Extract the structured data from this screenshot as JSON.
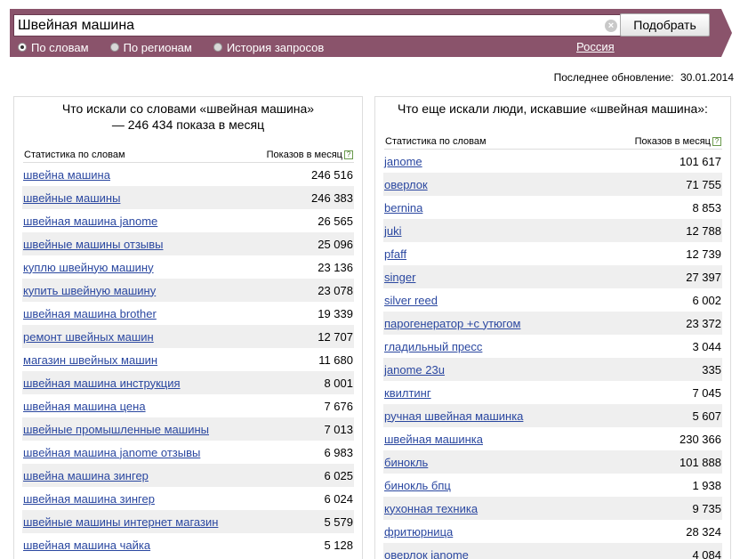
{
  "search": {
    "query": "Швейная машина",
    "clear_symbol": "×",
    "submit_label": "Подобрать",
    "modes": [
      {
        "label": "По словам",
        "checked": true
      },
      {
        "label": "По регионам",
        "checked": false
      },
      {
        "label": "История запросов",
        "checked": false
      }
    ],
    "region": "Россия"
  },
  "colors": {
    "banner": "#8a536b",
    "link": "#2a47a0",
    "row_alt": "#efefef"
  },
  "updated": {
    "label": "Последнее обновление:",
    "date": "30.01.2014"
  },
  "left_panel": {
    "title": "Что искали со словами «швейная машина» — 246 434 показа в месяц",
    "col_words": "Статистика по словам",
    "col_count": "Показов в месяц",
    "help": "?",
    "rows": [
      {
        "phrase": "швейна машина",
        "count": "246 516"
      },
      {
        "phrase": "швейные машины",
        "count": "246 383"
      },
      {
        "phrase": "швейная машина janome",
        "count": "26 565"
      },
      {
        "phrase": "швейные машины отзывы",
        "count": "25 096"
      },
      {
        "phrase": "куплю швейную машину",
        "count": "23 136"
      },
      {
        "phrase": "купить швейную машину",
        "count": "23 078"
      },
      {
        "phrase": "швейная машина brother",
        "count": "19 339"
      },
      {
        "phrase": "ремонт швейных машин",
        "count": "12 707"
      },
      {
        "phrase": "магазин швейных машин",
        "count": "11 680"
      },
      {
        "phrase": "швейная машина инструкция",
        "count": "8 001"
      },
      {
        "phrase": "швейная машина цена",
        "count": "7 676"
      },
      {
        "phrase": "швейные промышленные машины",
        "count": "7 013"
      },
      {
        "phrase": "швейная машина janome отзывы",
        "count": "6 983"
      },
      {
        "phrase": "швейна машина зингер",
        "count": "6 025"
      },
      {
        "phrase": "швейная машина зингер",
        "count": "6 024"
      },
      {
        "phrase": "швейные машины интернет магазин",
        "count": "5 579"
      },
      {
        "phrase": "швейная машина чайка",
        "count": "5 128"
      }
    ]
  },
  "right_panel": {
    "title": "Что еще искали люди, искавшие «швейная машина»:",
    "col_words": "Статистика по словам",
    "col_count": "Показов в месяц",
    "help": "?",
    "rows": [
      {
        "phrase": "janome",
        "count": "101 617"
      },
      {
        "phrase": "оверлок",
        "count": "71 755"
      },
      {
        "phrase": "bernina",
        "count": "8 853"
      },
      {
        "phrase": "juki",
        "count": "12 788"
      },
      {
        "phrase": "pfaff",
        "count": "12 739"
      },
      {
        "phrase": "singer",
        "count": "27 397"
      },
      {
        "phrase": "silver reed",
        "count": "6 002"
      },
      {
        "phrase": "парогенератор +с утюгом",
        "count": "23 372"
      },
      {
        "phrase": "гладильный пресс",
        "count": "3 044"
      },
      {
        "phrase": "janome 23u",
        "count": "335"
      },
      {
        "phrase": "квилтинг",
        "count": "7 045"
      },
      {
        "phrase": "ручная швейная машинка",
        "count": "5 607"
      },
      {
        "phrase": "швейная машинка",
        "count": "230 366"
      },
      {
        "phrase": "бинокль",
        "count": "101 888"
      },
      {
        "phrase": "бинокль бпц",
        "count": "1 938"
      },
      {
        "phrase": "кухонная техника",
        "count": "9 735"
      },
      {
        "phrase": "фритюрница",
        "count": "28 324"
      },
      {
        "phrase": "оверлок janome",
        "count": "4 084"
      }
    ]
  }
}
